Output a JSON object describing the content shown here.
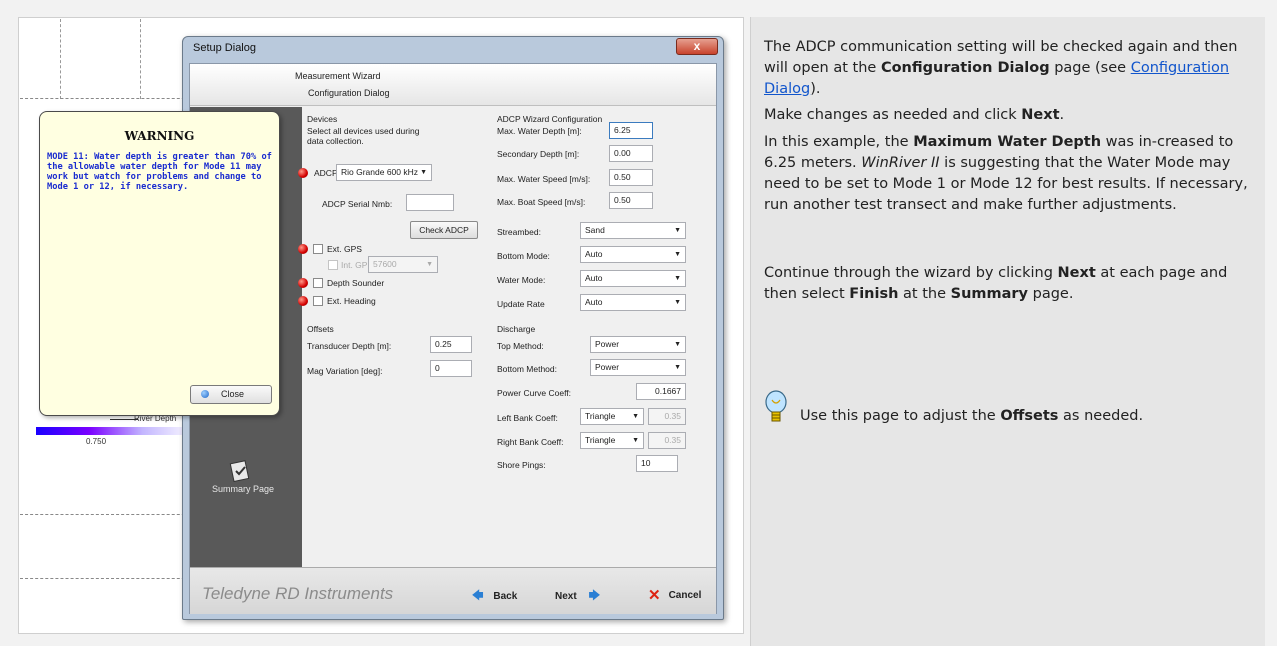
{
  "right_panel": {
    "p1_a": "The ADCP communication setting will be checked again and then will open at the ",
    "p1_b": "Configuration Dialog",
    "p1_c": " page (see ",
    "p1_link": "Configuration Dialog",
    "p1_d": ").",
    "p2_a": "Make changes as needed and click ",
    "p2_b": "Next",
    "p2_c": ".",
    "p3_a": "In this example, the ",
    "p3_b": "Maximum Water Depth",
    "p3_c": " was in-creased to 6.25 meters. ",
    "p3_d": "WinRiver II",
    "p3_e": " is suggesting that the Water Mode may need to be set to Mode 1 or Mode 12 for best results. If necessary, run another test transect and make further adjustments.",
    "p4_a": "Continue through the wizard by clicking ",
    "p4_b": "Next",
    "p4_c": " at each page and then select ",
    "p4_d": "Finish",
    "p4_e": " at the ",
    "p4_f": "Summary",
    "p4_g": " page.",
    "tip_a": "Use this page to adjust the ",
    "tip_b": "Offsets",
    "tip_c": " as needed."
  },
  "background": {
    "river_label": "River Depth",
    "scale_value": "0.750"
  },
  "dialog": {
    "title": "Setup Dialog",
    "close_glyph": "x",
    "header_line1": "Measurement Wizard",
    "header_line2": "Configuration Dialog",
    "sidebar_item": "Summary Page",
    "brand": "Teledyne RD Instruments",
    "back": "Back",
    "next": "Next",
    "cancel": "Cancel",
    "devices": {
      "heading": "Devices",
      "note": "Select all devices used during data collection.",
      "adcp_label": "ADCP:",
      "adcp_value": "Rio Grande 600 kHz",
      "serial_label": "ADCP Serial Nmb:",
      "serial_value": "",
      "check_button": "Check ADCP",
      "ext_gps": "Ext. GPS",
      "int_gps": "Int. GPS",
      "int_gps_value": "57600",
      "depth_sounder": "Depth Sounder",
      "ext_heading": "Ext. Heading"
    },
    "offsets": {
      "heading": "Offsets",
      "transducer_label": "Transducer Depth [m]:",
      "transducer_value": "0.25",
      "magvar_label": "Mag Variation [deg]:",
      "magvar_value": "0"
    },
    "wizard": {
      "heading": "ADCP Wizard Configuration",
      "max_depth_label": "Max. Water Depth [m]:",
      "max_depth_value": "6.25",
      "secondary_label": "Secondary Depth [m]:",
      "secondary_value": "0.00",
      "water_speed_label": "Max. Water Speed [m/s]:",
      "water_speed_value": "0.50",
      "boat_speed_label": "Max. Boat Speed [m/s]:",
      "boat_speed_value": "0.50",
      "streambed_label": "Streambed:",
      "streambed_value": "Sand",
      "bottom_mode_label": "Bottom Mode:",
      "bottom_mode_value": "Auto",
      "water_mode_label": "Water Mode:",
      "water_mode_value": "Auto",
      "update_rate_label": "Update Rate",
      "update_rate_value": "Auto"
    },
    "discharge": {
      "heading": "Discharge",
      "top_label": "Top Method:",
      "top_value": "Power",
      "bottom_label": "Bottom Method:",
      "bottom_value": "Power",
      "power_label": "Power Curve Coeff:",
      "power_value": "0.1667",
      "left_label": "Left Bank Coeff:",
      "left_value": "Triangle",
      "left_coeff": "0.35",
      "right_label": "Right Bank Coeff:",
      "right_value": "Triangle",
      "right_coeff": "0.35",
      "shore_label": "Shore Pings:",
      "shore_value": "10"
    }
  },
  "warning": {
    "title": "WARNING",
    "message": "MODE 11: Water depth is greater than 70% of the allowable water depth for Mode 11 may work but watch for problems and change to Mode 1 or 12, if necessary.",
    "close": "Close"
  }
}
